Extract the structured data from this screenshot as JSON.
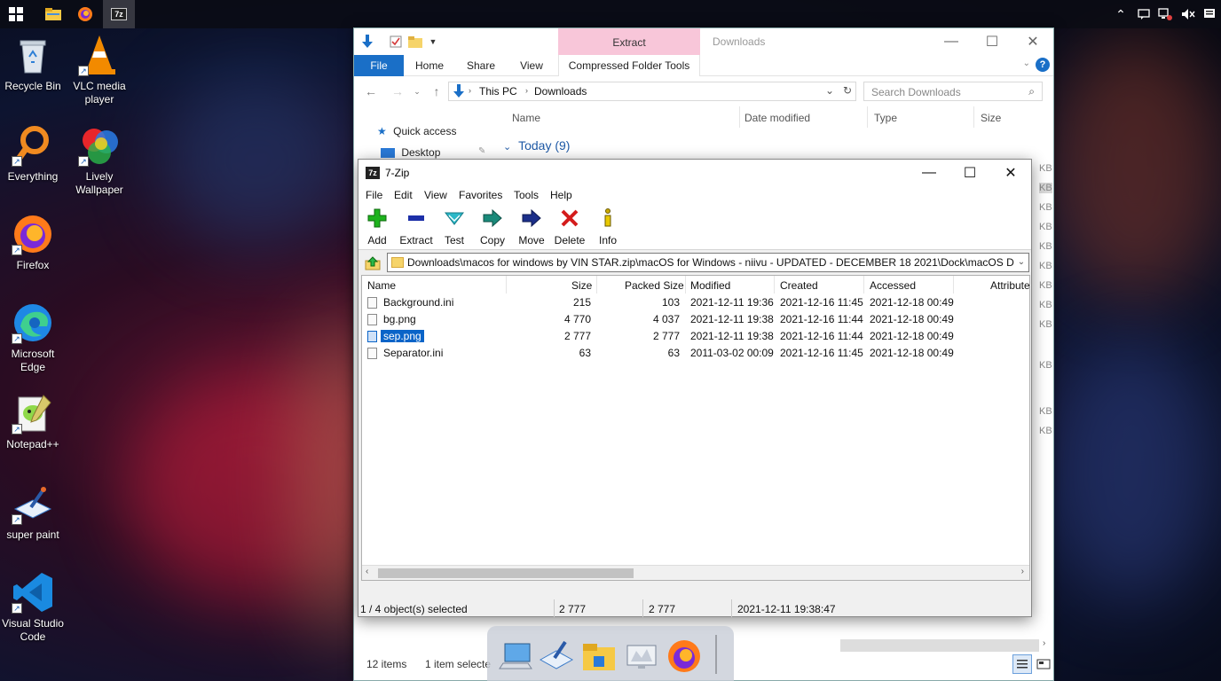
{
  "desktop": {
    "icons": [
      {
        "label": "Recycle Bin",
        "icon": "recycle-bin-icon"
      },
      {
        "label": "VLC media player",
        "icon": "vlc-cone-icon"
      },
      {
        "label": "Everything",
        "icon": "everything-search-icon"
      },
      {
        "label": "Lively Wallpaper",
        "icon": "lively-wallpaper-icon"
      },
      {
        "label": "Firefox",
        "icon": "firefox-icon"
      },
      {
        "label": "Microsoft Edge",
        "icon": "edge-icon"
      },
      {
        "label": "Notepad++",
        "icon": "notepad-plus-plus-icon"
      },
      {
        "label": "super paint",
        "icon": "super-paint-icon"
      },
      {
        "label": "Visual Studio Code",
        "icon": "vscode-icon"
      }
    ]
  },
  "taskbar": {
    "start": "windows-logo-icon",
    "apps": [
      "file-explorer-icon",
      "firefox-icon",
      "7zip-icon"
    ],
    "tray": [
      "chevron-up-icon",
      "chat-icon",
      "network-icon",
      "volume-muted-icon",
      "notifications-icon"
    ]
  },
  "explorer": {
    "context_tab": "Extract",
    "window_title": "Downloads",
    "tabs": [
      "File",
      "Home",
      "Share",
      "View",
      "Compressed Folder Tools"
    ],
    "breadcrumb": [
      "This PC",
      "Downloads"
    ],
    "search_placeholder": "Search Downloads",
    "columns": [
      "Name",
      "Date modified",
      "Type",
      "Size"
    ],
    "nav": {
      "quick_access": "Quick access",
      "desktop": "Desktop"
    },
    "group_label": "Today (9)",
    "size_fragments": [
      "KB",
      "KB",
      "KB",
      "KB",
      "KB",
      "KB",
      "KB",
      "KB",
      "KB",
      "KB",
      "KB",
      "KB"
    ],
    "status": {
      "items": "12 items",
      "selected": "1 item selecte"
    }
  },
  "zip": {
    "title": "7-Zip",
    "logo": "7z",
    "menu": [
      "File",
      "Edit",
      "View",
      "Favorites",
      "Tools",
      "Help"
    ],
    "toolbar": [
      {
        "label": "Add",
        "icon": "add-plus-icon",
        "color": "#1cb31c"
      },
      {
        "label": "Extract",
        "icon": "extract-minus-icon",
        "color": "#1c2fa8"
      },
      {
        "label": "Test",
        "icon": "test-check-icon",
        "color": "#2bb8c8"
      },
      {
        "label": "Copy",
        "icon": "copy-arrow-icon",
        "color": "#1a8a7a"
      },
      {
        "label": "Move",
        "icon": "move-arrow-icon",
        "color": "#1c2f8a"
      },
      {
        "label": "Delete",
        "icon": "delete-x-icon",
        "color": "#d41c1c"
      },
      {
        "label": "Info",
        "icon": "info-icon",
        "color": "#c8a800"
      }
    ],
    "path": "Downloads\\macos for windows by VIN STAR.zip\\macOS for Windows - niivu - UPDATED - DECEMBER 18 2021\\Dock\\macOS Day\\",
    "columns": [
      "Name",
      "Size",
      "Packed Size",
      "Modified",
      "Created",
      "Accessed",
      "Attributes"
    ],
    "rows": [
      {
        "name": "Background.ini",
        "size": "215",
        "packed": "103",
        "modified": "2021-12-11 19:36",
        "created": "2021-12-16 11:45",
        "accessed": "2021-12-18 00:49",
        "selected": false
      },
      {
        "name": "bg.png",
        "size": "4 770",
        "packed": "4 037",
        "modified": "2021-12-11 19:38",
        "created": "2021-12-16 11:44",
        "accessed": "2021-12-18 00:49",
        "selected": false
      },
      {
        "name": "sep.png",
        "size": "2 777",
        "packed": "2 777",
        "modified": "2021-12-11 19:38",
        "created": "2021-12-16 11:44",
        "accessed": "2021-12-18 00:49",
        "selected": true
      },
      {
        "name": "Separator.ini",
        "size": "63",
        "packed": "63",
        "modified": "2011-03-02 00:09",
        "created": "2021-12-16 11:45",
        "accessed": "2021-12-18 00:49",
        "selected": false
      }
    ],
    "status": {
      "selection": "1 / 4 object(s) selected",
      "size": "2 777",
      "packed": "2 777",
      "modified": "2021-12-11 19:38:47"
    }
  },
  "dock": {
    "items": [
      "this-pc-icon",
      "super-paint-icon",
      "file-explorer-icon",
      "display-settings-icon",
      "firefox-icon"
    ]
  },
  "colors": {
    "accent": "#0a64c8",
    "explorer_file_tab": "#1a6fc7",
    "context_tab": "#f8c6d9"
  }
}
